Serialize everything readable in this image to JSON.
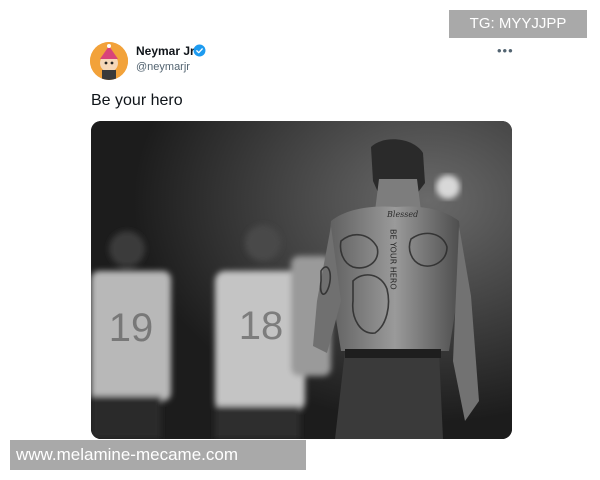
{
  "tweet": {
    "author_name": "Neymar Jr",
    "author_handle": "@neymarjr",
    "verified": true,
    "text": "Be your hero",
    "menu_icon": "more-horizontal-icon",
    "media": {
      "description_icon": "photo",
      "jersey_numbers": [
        "19",
        "18"
      ],
      "tattoo_script": "Blessed",
      "tattoo_vertical_text": "BE YOUR HERO"
    }
  },
  "watermarks": {
    "top": "TG: MYYJJPP",
    "bottom": "www.melamine-mecame.com"
  },
  "colors": {
    "verified_blue": "#1d9bf0",
    "secondary_text": "#536471",
    "avatar_bg": "#f2a23a"
  }
}
